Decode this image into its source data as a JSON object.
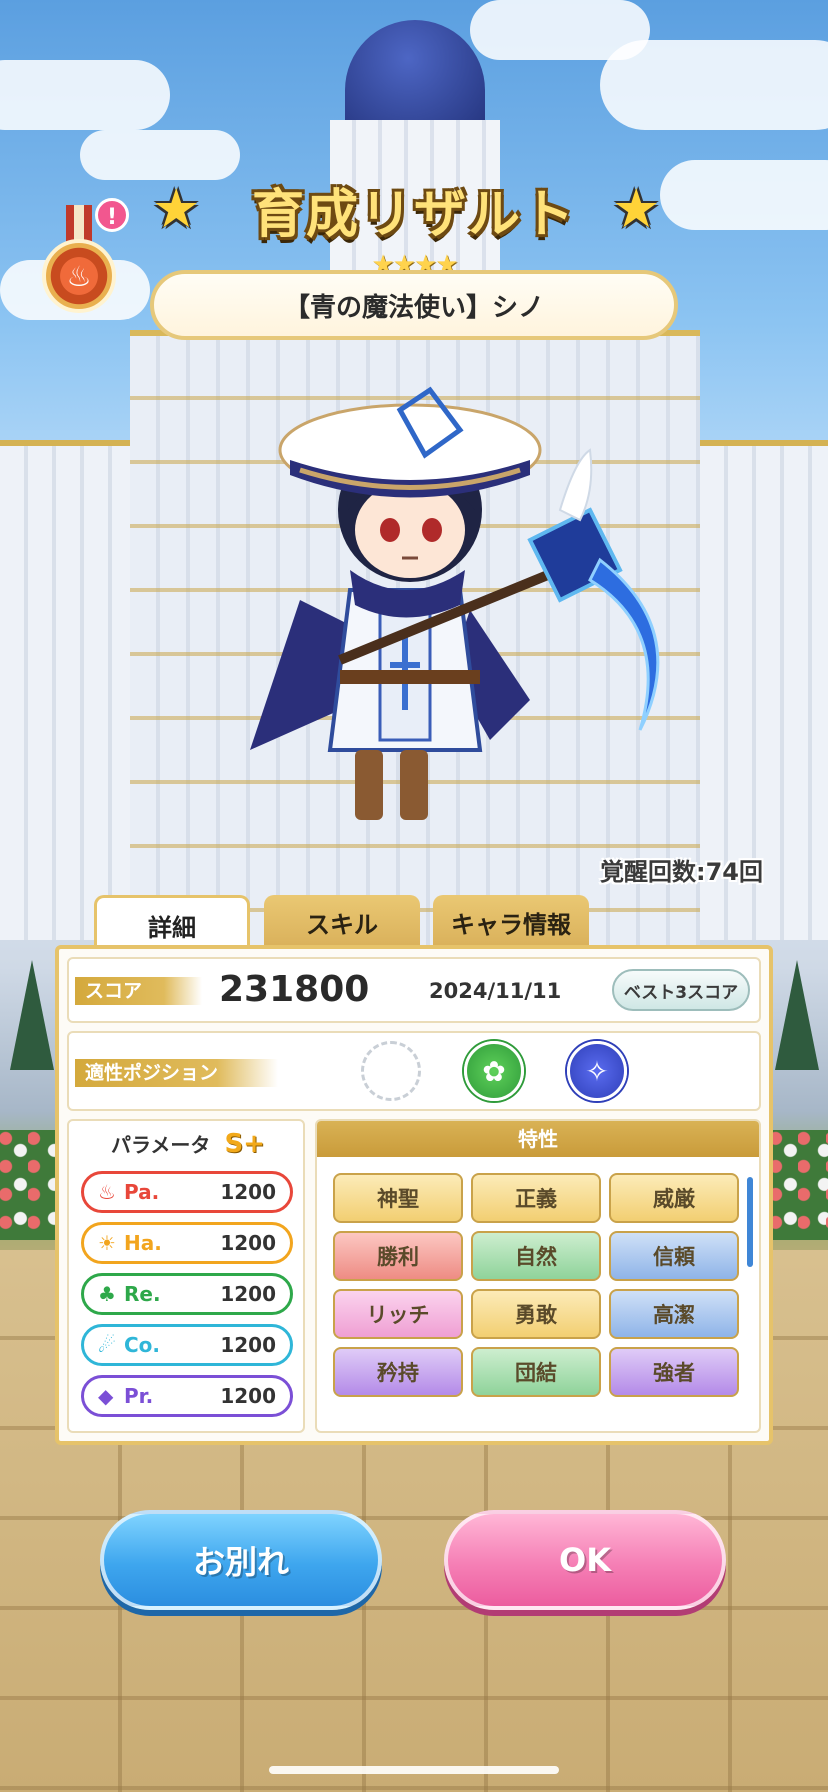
{
  "header": {
    "title": "育成リザルト",
    "rarity_stars": "★★★★",
    "character_name": "【青の魔法使い】シノ",
    "medal_alert": "!"
  },
  "awaken_count": "覚醒回数:74回",
  "tabs": [
    {
      "label": "詳細",
      "active": true
    },
    {
      "label": "スキル",
      "active": false
    },
    {
      "label": "キャラ情報",
      "active": false
    }
  ],
  "score": {
    "label": "スコア",
    "value": "231800",
    "date": "2024/11/11",
    "best_button": "ベスト3スコア"
  },
  "position": {
    "label": "適性ポジション",
    "icons": [
      "empty-slot",
      "green-fairy-icon",
      "blue-rocket-icon"
    ]
  },
  "parameters": {
    "label": "パラメータ",
    "rank": "S+",
    "stats": [
      {
        "name": "Pa.",
        "value": "1200",
        "color": "#e8473a",
        "icon": "flame-icon"
      },
      {
        "name": "Ha.",
        "value": "1200",
        "color": "#f2a51e",
        "icon": "sun-icon"
      },
      {
        "name": "Re.",
        "value": "1200",
        "color": "#2ea84a",
        "icon": "clover-icon"
      },
      {
        "name": "Co.",
        "value": "1200",
        "color": "#2fb6d8",
        "icon": "swirl-icon"
      },
      {
        "name": "Pr.",
        "value": "1200",
        "color": "#7b4fd6",
        "icon": "diamond-icon"
      }
    ]
  },
  "traits": {
    "label": "特性",
    "items": [
      {
        "label": "神聖",
        "color": "#f7d98a"
      },
      {
        "label": "正義",
        "color": "#f7d98a"
      },
      {
        "label": "威厳",
        "color": "#f7d98a"
      },
      {
        "label": "勝利",
        "color": "#f5a3a3"
      },
      {
        "label": "自然",
        "color": "#a8ddb0"
      },
      {
        "label": "信頼",
        "color": "#a9c6ee"
      },
      {
        "label": "リッチ",
        "color": "#f4b0dc"
      },
      {
        "label": "勇敢",
        "color": "#f7d98a"
      },
      {
        "label": "高潔",
        "color": "#a9c6ee"
      },
      {
        "label": "矜持",
        "color": "#c8a6ef"
      },
      {
        "label": "団結",
        "color": "#a8ddb0"
      },
      {
        "label": "強者",
        "color": "#c8a6ef"
      }
    ]
  },
  "buttons": {
    "farewell": "お別れ",
    "ok": "OK"
  }
}
